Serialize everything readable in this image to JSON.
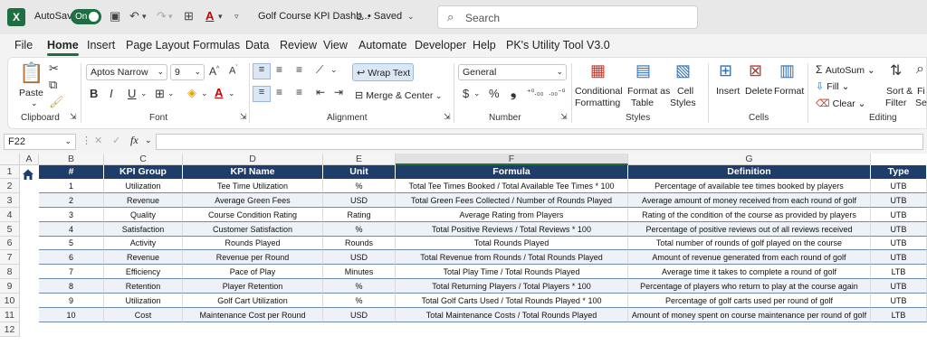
{
  "titlebar": {
    "autosave_label": "AutoSave",
    "toggle_label": "On",
    "file_title": "Golf Course KPI Dashb...",
    "saved_label": "• Saved",
    "search_placeholder": "Search"
  },
  "menu": [
    "File",
    "Home",
    "Insert",
    "Page Layout",
    "Formulas",
    "Data",
    "Review",
    "View",
    "Automate",
    "Developer",
    "Help",
    "PK's Utility Tool V3.0"
  ],
  "ribbon": {
    "paste": "Paste",
    "clipboard": "Clipboard",
    "font_name": "Aptos Narrow",
    "font_size": "9",
    "font_group": "Font",
    "wrap_text": "Wrap Text",
    "merge_center": "Merge & Center",
    "alignment_group": "Alignment",
    "number_format": "General",
    "number_group": "Number",
    "conditional_formatting_1": "Conditional",
    "conditional_formatting_2": "Formatting",
    "format_as_table_1": "Format as",
    "format_as_table_2": "Table",
    "cell_styles_1": "Cell",
    "cell_styles_2": "Styles",
    "styles_group": "Styles",
    "insert": "Insert",
    "delete": "Delete",
    "format": "Format",
    "cells_group": "Cells",
    "autosum": "AutoSum",
    "fill": "Fill",
    "clear": "Clear",
    "sort_filter_1": "Sort &",
    "sort_filter_2": "Filter",
    "find_1": "Fi",
    "find_2": "Sel",
    "editing_group": "Editing"
  },
  "formula_bar": {
    "name_box": "F22",
    "fx": "fx",
    "formula": ""
  },
  "sheet": {
    "columns": [
      "A",
      "B",
      "C",
      "D",
      "E",
      "F",
      "G"
    ],
    "rows": [
      "1",
      "2",
      "3",
      "4",
      "5",
      "6",
      "7",
      "8",
      "9",
      "10",
      "11",
      "12"
    ],
    "headers": [
      "#",
      "KPI Group",
      "KPI Name",
      "Unit",
      "Formula",
      "Definition",
      "Type"
    ],
    "data": [
      [
        "1",
        "Utilization",
        "Tee Time Utilization",
        "%",
        "Total Tee Times Booked / Total Available Tee Times * 100",
        "Percentage of available tee times booked by players",
        "UTB"
      ],
      [
        "2",
        "Revenue",
        "Average Green Fees",
        "USD",
        "Total Green Fees Collected / Number of Rounds Played",
        "Average amount of money received from each round of golf",
        "UTB"
      ],
      [
        "3",
        "Quality",
        "Course Condition Rating",
        "Rating",
        "Average Rating from Players",
        "Rating of the condition of the course as provided by players",
        "UTB"
      ],
      [
        "4",
        "Satisfaction",
        "Customer Satisfaction",
        "%",
        "Total Positive Reviews / Total Reviews * 100",
        "Percentage of positive reviews out of all reviews received",
        "UTB"
      ],
      [
        "5",
        "Activity",
        "Rounds Played",
        "Rounds",
        "Total Rounds Played",
        "Total number of rounds of golf played on the course",
        "UTB"
      ],
      [
        "6",
        "Revenue",
        "Revenue per Round",
        "USD",
        "Total Revenue from Rounds / Total Rounds Played",
        "Amount of revenue generated from each round of golf",
        "UTB"
      ],
      [
        "7",
        "Efficiency",
        "Pace of Play",
        "Minutes",
        "Total Play Time / Total Rounds Played",
        "Average time it takes to complete a round of golf",
        "LTB"
      ],
      [
        "8",
        "Retention",
        "Player Retention",
        "%",
        "Total Returning Players / Total Players * 100",
        "Percentage of players who return to play at the course again",
        "UTB"
      ],
      [
        "9",
        "Utilization",
        "Golf Cart Utilization",
        "%",
        "Total Golf Carts Used / Total Rounds Played * 100",
        "Percentage of golf carts used per round of golf",
        "UTB"
      ],
      [
        "10",
        "Cost",
        "Maintenance Cost per Round",
        "USD",
        "Total Maintenance Costs / Total Rounds Played",
        "Amount of money spent on course maintenance per round of golf",
        "LTB"
      ]
    ]
  },
  "colors": {
    "accent": "#1d6f42",
    "header_fill": "#1f3d6b",
    "row_fill_alt": "#eef2f8"
  }
}
